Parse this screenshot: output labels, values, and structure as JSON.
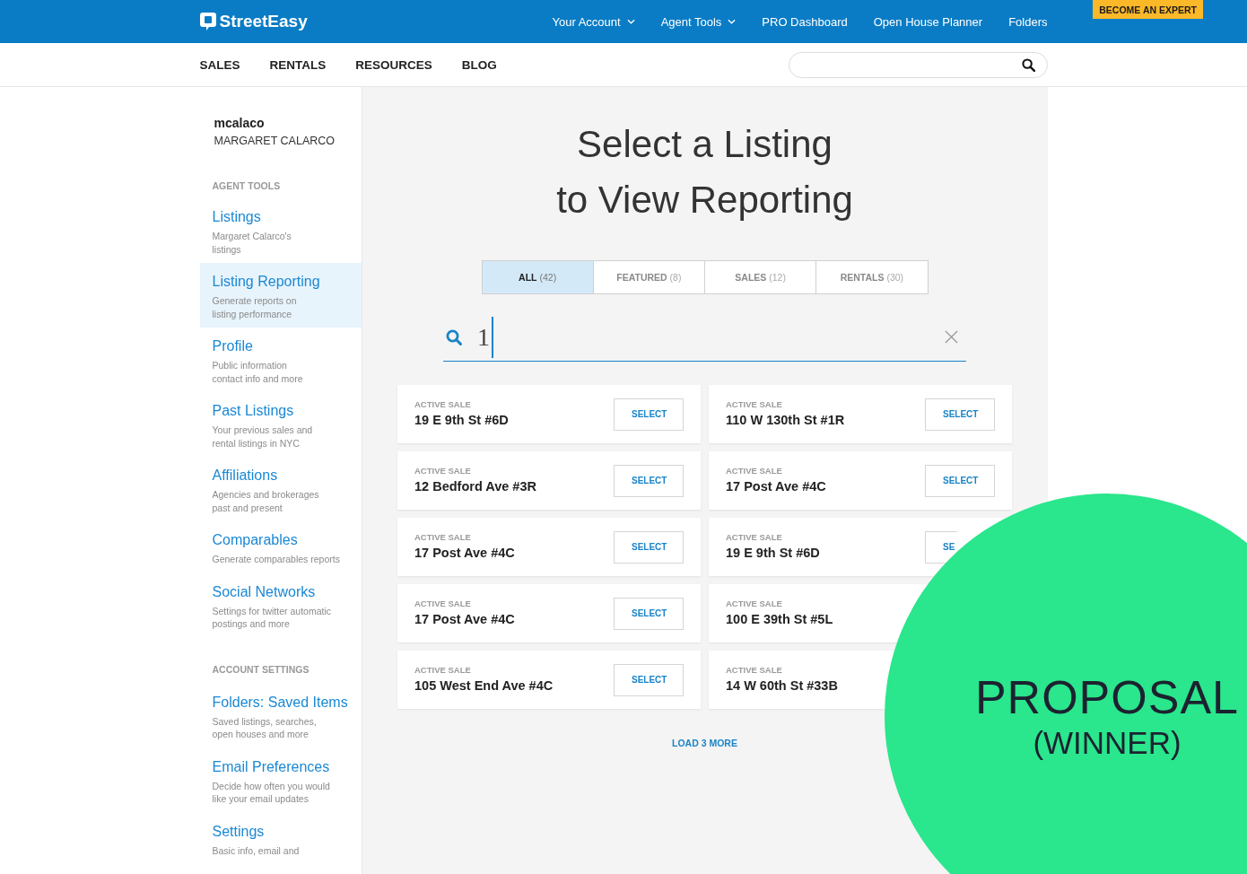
{
  "header": {
    "logo": "StreetEasy",
    "nav": [
      {
        "label": "Your Account",
        "dropdown": true
      },
      {
        "label": "Agent Tools",
        "dropdown": true
      },
      {
        "label": "PRO Dashboard",
        "dropdown": false
      },
      {
        "label": "Open House Planner",
        "dropdown": false
      },
      {
        "label": "Folders",
        "dropdown": false
      }
    ],
    "cta": "BECOME AN EXPERT"
  },
  "subnav": {
    "links": [
      "SALES",
      "RENTALS",
      "RESOURCES",
      "BLOG"
    ]
  },
  "sidebar": {
    "username": "mcalaco",
    "full_name": "MARGARET CALARCO",
    "sections": [
      {
        "heading": "AGENT TOOLS",
        "items": [
          {
            "title": "Listings",
            "description": "Margaret Calarco's\nlistings",
            "selected": false
          },
          {
            "title": "Listing Reporting",
            "description": "Generate reports on\nlisting performance",
            "selected": true
          },
          {
            "title": "Profile",
            "description": "Public information\ncontact info and more",
            "selected": false
          },
          {
            "title": "Past Listings",
            "description": "Your previous sales and\nrental listings in NYC",
            "selected": false
          },
          {
            "title": "Affiliations",
            "description": "Agencies and brokerages\npast and present",
            "selected": false
          },
          {
            "title": "Comparables",
            "description": "Generate comparables reports",
            "selected": false
          },
          {
            "title": "Social Networks",
            "description": "Settings for twitter automatic\npostings and more",
            "selected": false
          }
        ]
      },
      {
        "heading": "ACCOUNT SETTINGS",
        "items": [
          {
            "title": "Folders: Saved Items",
            "description": "Saved listings, searches,\nopen houses and more",
            "selected": false
          },
          {
            "title": "Email Preferences",
            "description": "Decide how often you would\nlike your email updates",
            "selected": false
          },
          {
            "title": "Settings",
            "description": "Basic info, email and",
            "selected": false
          }
        ]
      }
    ]
  },
  "main": {
    "title": "Select a Listing\nto View Reporting",
    "tabs": [
      {
        "label": "ALL",
        "count": "(42)",
        "selected": true
      },
      {
        "label": "FEATURED",
        "count": "(8)",
        "selected": false
      },
      {
        "label": "SALES",
        "count": "(12)",
        "selected": false
      },
      {
        "label": "RENTALS",
        "count": "(30)",
        "selected": false
      }
    ],
    "search": {
      "value": "1",
      "focused": true
    },
    "listings": [
      {
        "status": "ACTIVE SALE",
        "address": "19 E 9th St #6D",
        "button": "SELECT",
        "partly_hidden": false
      },
      {
        "status": "ACTIVE SALE",
        "address": "110 W 130th St #1R",
        "button": "SELECT",
        "partly_hidden": false
      },
      {
        "status": "ACTIVE SALE",
        "address": "12 Bedford Ave #3R",
        "button": "SELECT",
        "partly_hidden": false
      },
      {
        "status": "ACTIVE SALE",
        "address": "17 Post Ave #4C",
        "button": "SELECT",
        "partly_hidden": false
      },
      {
        "status": "ACTIVE SALE",
        "address": "17 Post Ave #4C",
        "button": "SELECT",
        "partly_hidden": false
      },
      {
        "status": "ACTIVE SALE",
        "address": "19 E 9th St #6D",
        "button": "SE",
        "partly_hidden": true
      },
      {
        "status": "ACTIVE SALE",
        "address": "17 Post Ave #4C",
        "button": "SELECT",
        "partly_hidden": false
      },
      {
        "status": "ACTIVE SALE",
        "address": "100 E 39th St #5L"
      },
      {
        "status": "ACTIVE SALE",
        "address": "105 West End Ave #4C",
        "button": "SELECT",
        "partly_hidden": false
      },
      {
        "status": "ACTIVE SALE",
        "address": "14 W 60th St #33B"
      }
    ],
    "load_more": "LOAD 3 MORE"
  },
  "overlay": {
    "title": "PROPOSAL",
    "subtitle": "(WINNER)"
  }
}
